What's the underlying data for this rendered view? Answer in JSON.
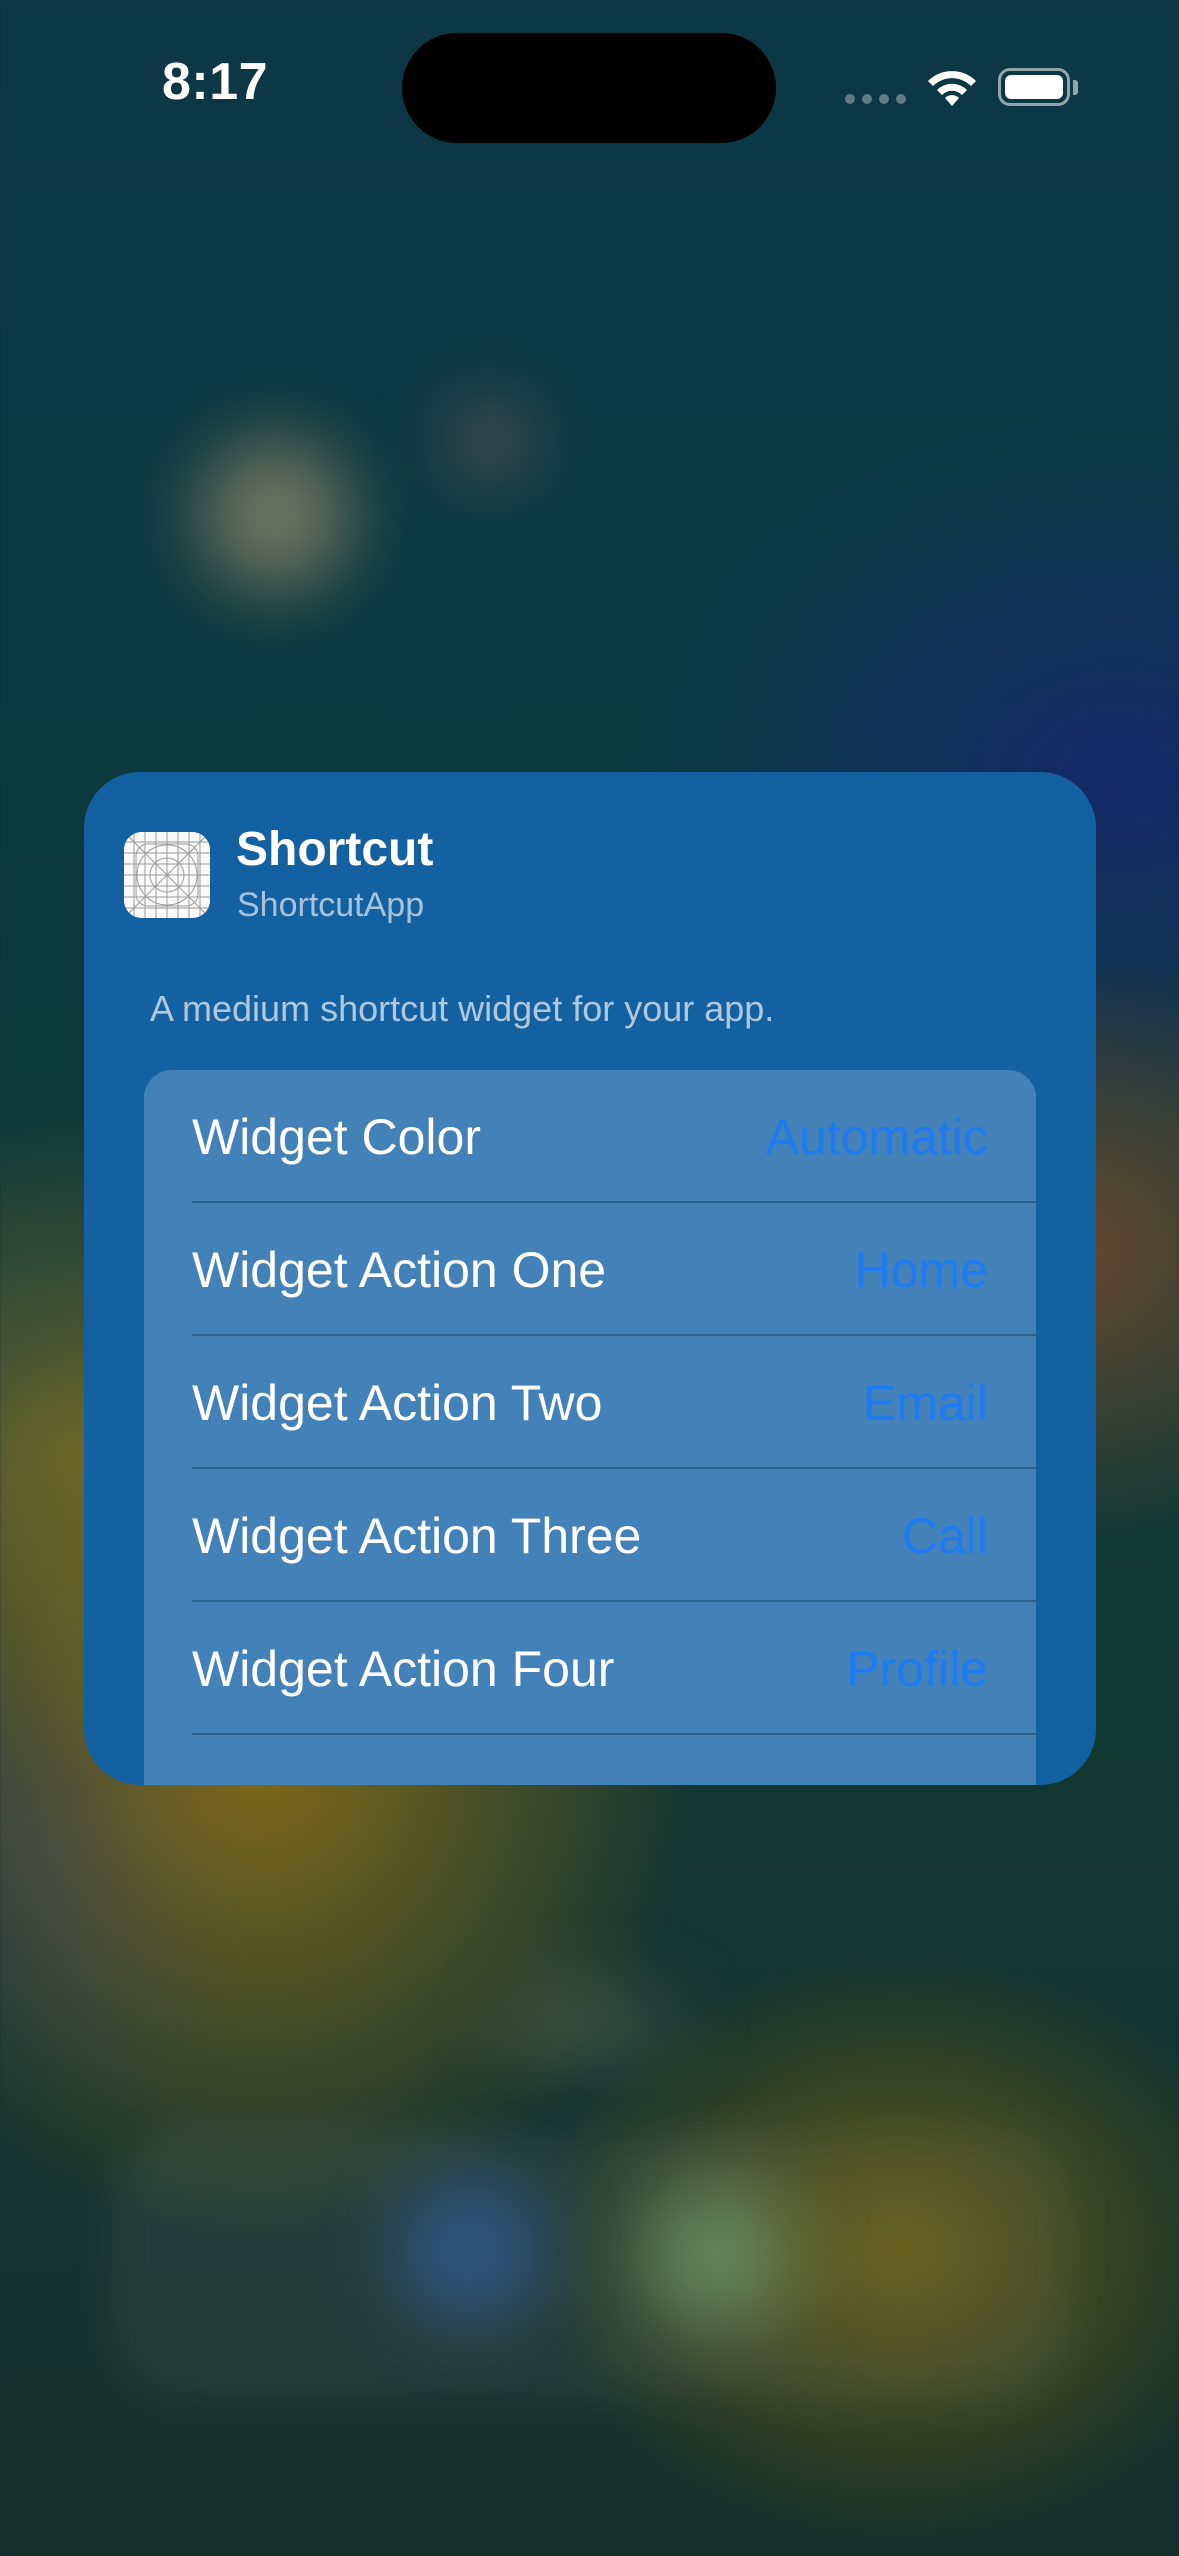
{
  "status_bar": {
    "time": "8:17"
  },
  "widget": {
    "app_name": "Shortcut",
    "app_subtitle": "ShortcutApp",
    "description": "A medium shortcut widget for your app.",
    "icon": "app-grid-icon",
    "settings": [
      {
        "label": "Widget Color",
        "value": "Automatic"
      },
      {
        "label": "Widget Action One",
        "value": "Home"
      },
      {
        "label": "Widget Action Two",
        "value": "Email"
      },
      {
        "label": "Widget Action Three",
        "value": "Call"
      },
      {
        "label": "Widget Action Four",
        "value": "Profile"
      },
      {
        "label": "",
        "value": ""
      }
    ]
  },
  "colors": {
    "widget_background": "#1461a2",
    "list_background": "#4382b8",
    "value_accent": "#1f79ef"
  }
}
